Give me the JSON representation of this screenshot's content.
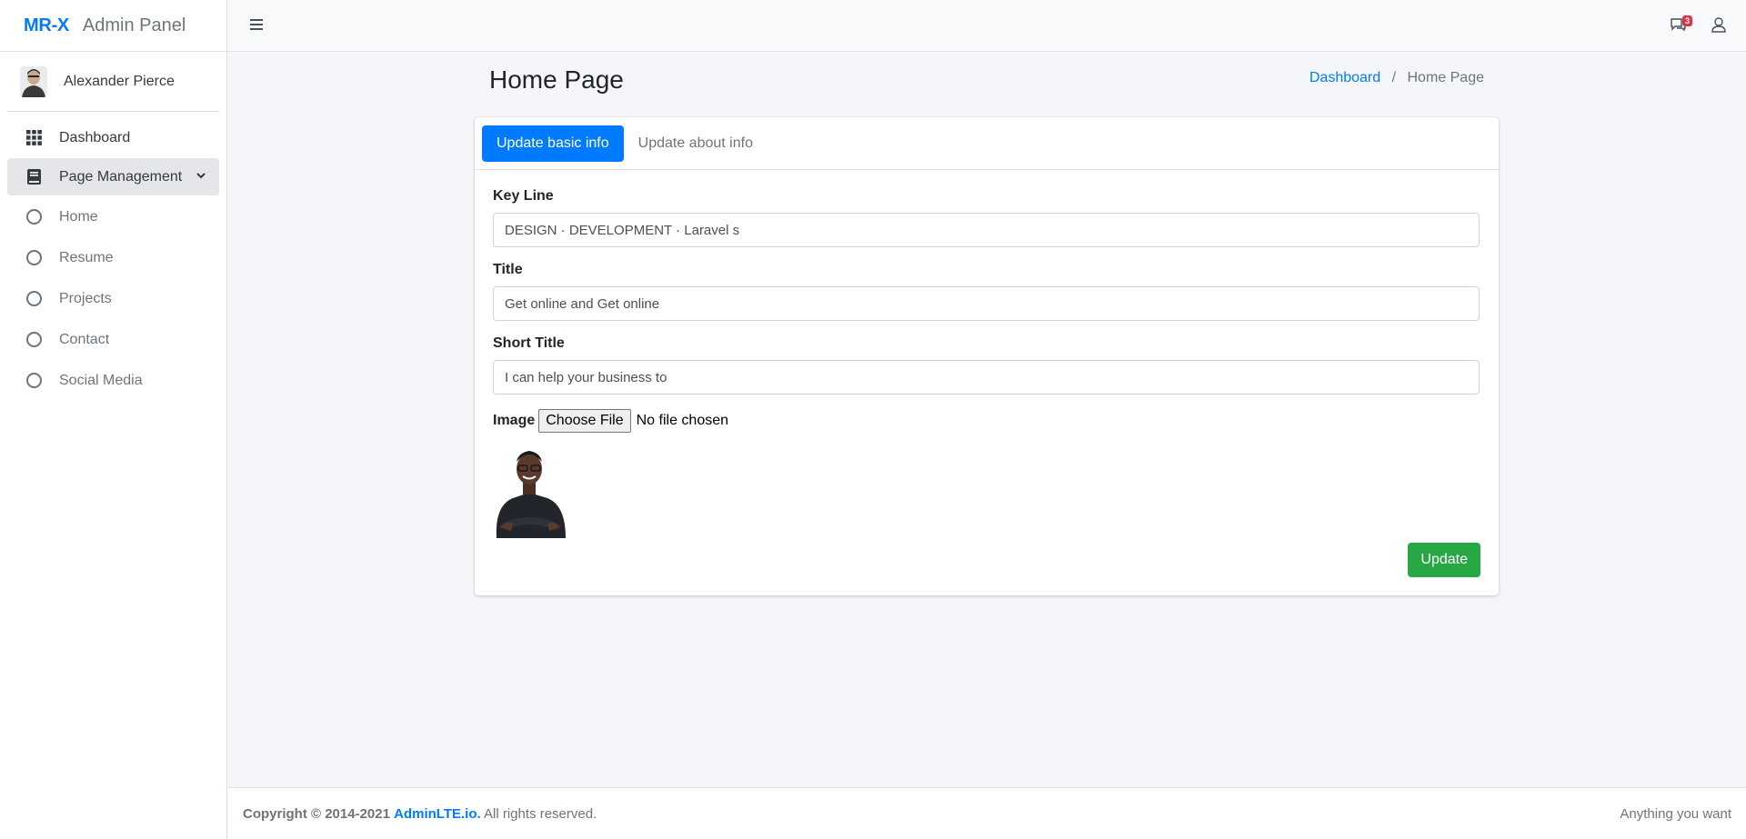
{
  "brand": {
    "logo": "MR-X",
    "text": "Admin Panel"
  },
  "user": {
    "name": "Alexander Pierce"
  },
  "sidebar": {
    "items": [
      {
        "label": "Dashboard",
        "icon": "grid-icon"
      },
      {
        "label": "Page Management",
        "icon": "book-icon",
        "expanded": true
      }
    ],
    "subitems": [
      {
        "label": "Home"
      },
      {
        "label": "Resume"
      },
      {
        "label": "Projects"
      },
      {
        "label": "Contact"
      },
      {
        "label": "Social Media"
      }
    ]
  },
  "topbar": {
    "message_count": "3"
  },
  "header": {
    "title": "Home Page",
    "breadcrumb": {
      "link": "Dashboard",
      "sep": "/",
      "current": "Home Page"
    }
  },
  "tabs": [
    {
      "label": "Update basic info",
      "active": true
    },
    {
      "label": "Update about info",
      "active": false
    }
  ],
  "form": {
    "key_line": {
      "label": "Key Line",
      "value": "DESIGN · DEVELOPMENT · Laravel s"
    },
    "title": {
      "label": "Title",
      "value": "Get online and Get online"
    },
    "short_title": {
      "label": "Short Title",
      "value": "I can help your business to"
    },
    "image": {
      "label": "Image",
      "button": "Choose File",
      "status": "No file chosen"
    },
    "submit": "Update"
  },
  "footer": {
    "copyright_prefix": "Copyright © 2014-2021",
    "brand_link": "AdminLTE.io.",
    "copyright_suffix": "All rights reserved.",
    "right_text": "Anything you want"
  },
  "colors": {
    "primary": "#007bff",
    "success": "#28a745",
    "danger": "#dc3545"
  }
}
